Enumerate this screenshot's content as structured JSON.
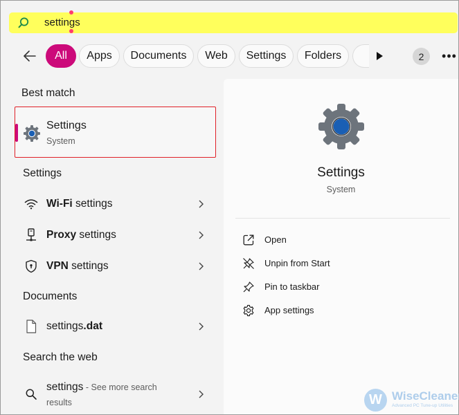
{
  "search": {
    "query": "settings"
  },
  "filters": {
    "tabs": [
      {
        "label": "All",
        "active": true
      },
      {
        "label": "Apps"
      },
      {
        "label": "Documents"
      },
      {
        "label": "Web"
      },
      {
        "label": "Settings"
      },
      {
        "label": "Folders"
      }
    ],
    "count_badge": "2",
    "more_label": "•••"
  },
  "best_match": {
    "heading": "Best match",
    "title": "Settings",
    "subtitle": "System"
  },
  "settings_section": {
    "heading": "Settings",
    "items": [
      {
        "bold": "Wi-Fi",
        "rest": " settings",
        "icon": "wifi-icon"
      },
      {
        "bold": "Proxy",
        "rest": " settings",
        "icon": "proxy-icon"
      },
      {
        "bold": "VPN",
        "rest": " settings",
        "icon": "shield-icon"
      }
    ]
  },
  "documents_section": {
    "heading": "Documents",
    "item": {
      "name": "settings",
      "ext": ".dat",
      "icon": "file-icon"
    }
  },
  "web_section": {
    "heading": "Search the web",
    "item": {
      "query": "settings",
      "sep": " - ",
      "hint_line1": "See more search",
      "hint_line2": "results",
      "icon": "search-icon"
    }
  },
  "detail": {
    "title": "Settings",
    "subtitle": "System",
    "actions": [
      {
        "label": "Open",
        "icon": "open-external-icon"
      },
      {
        "label": "Unpin from Start",
        "icon": "unpin-icon"
      },
      {
        "label": "Pin to taskbar",
        "icon": "pin-icon"
      },
      {
        "label": "App settings",
        "icon": "gear-icon"
      }
    ]
  },
  "watermark": {
    "name": "WiseCleaner",
    "tagline": "Advanced PC Tune-up Utilities",
    "logo_letter": "W"
  },
  "colors": {
    "accent": "#cc0a7a",
    "highlight": "#ffff5c",
    "selection_border": "#e01f26"
  }
}
